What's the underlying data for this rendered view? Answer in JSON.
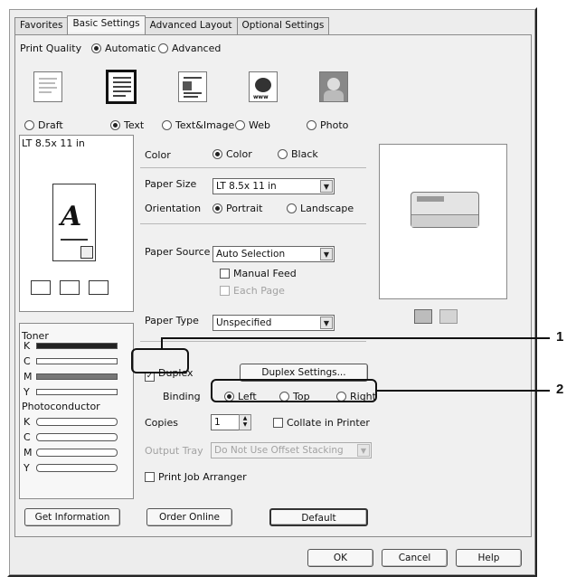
{
  "tabs": [
    "Favorites",
    "Basic Settings",
    "Advanced Layout",
    "Optional Settings"
  ],
  "print_quality": {
    "label": "Print Quality",
    "automatic": "Automatic",
    "advanced": "Advanced",
    "options": [
      "Draft",
      "Text",
      "Text&Image",
      "Web",
      "Photo"
    ],
    "selected": "Text"
  },
  "paper_preview": {
    "size_label": "LT 8.5x 11 in",
    "glyph": "A"
  },
  "color": {
    "label": "Color",
    "color": "Color",
    "black": "Black"
  },
  "paper_size": {
    "label": "Paper Size",
    "value": "LT 8.5x 11 in"
  },
  "orientation": {
    "label": "Orientation",
    "portrait": "Portrait",
    "landscape": "Landscape"
  },
  "paper_source": {
    "label": "Paper Source",
    "value": "Auto Selection",
    "manual_feed": "Manual Feed",
    "each_page": "Each Page"
  },
  "paper_type": {
    "label": "Paper Type",
    "value": "Unspecified"
  },
  "toner": {
    "label": "Toner",
    "rows": [
      {
        "k": "K",
        "level": 1.0
      },
      {
        "k": "C",
        "level": 0.0
      },
      {
        "k": "M",
        "level": 1.0
      },
      {
        "k": "Y",
        "level": 0.0
      }
    ]
  },
  "photoconductor": {
    "label": "Photoconductor",
    "rows": [
      "K",
      "C",
      "M",
      "Y"
    ]
  },
  "duplex": {
    "label": "Duplex",
    "settings_button": "Duplex Settings...",
    "binding_label": "Binding",
    "left": "Left",
    "top": "Top",
    "right": "Right"
  },
  "copies": {
    "label": "Copies",
    "value": "1",
    "collate": "Collate in Printer"
  },
  "output_tray": {
    "label": "Output Tray",
    "value": "Do Not Use Offset Stacking"
  },
  "print_job_arranger": "Print Job Arranger",
  "buttons": {
    "get_information": "Get Information",
    "order_online": "Order Online",
    "default": "Default",
    "ok": "OK",
    "cancel": "Cancel",
    "help": "Help"
  },
  "callouts": {
    "one": "1",
    "two": "2"
  }
}
